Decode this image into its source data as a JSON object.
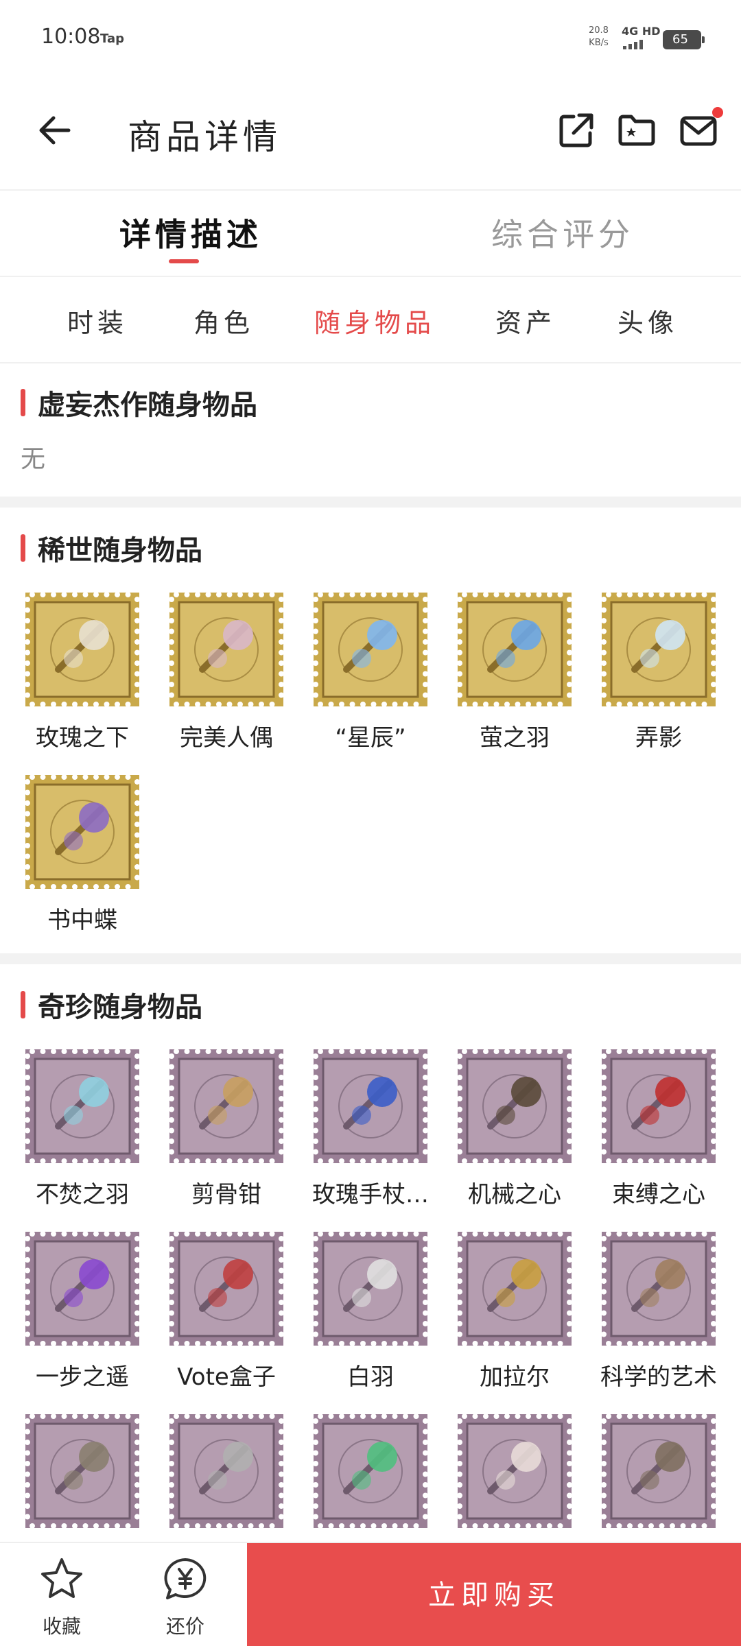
{
  "status": {
    "time": "10:08",
    "app_tag": "Tap",
    "speed_value": "20.8",
    "speed_unit": "KB/s",
    "network": "4G HD",
    "battery": "65"
  },
  "header": {
    "title": "商品详情"
  },
  "tabs": [
    {
      "label": "详情描述",
      "active": true
    },
    {
      "label": "综合评分",
      "active": false
    }
  ],
  "subtabs": [
    {
      "label": "时装",
      "active": false
    },
    {
      "label": "角色",
      "active": false
    },
    {
      "label": "随身物品",
      "active": true
    },
    {
      "label": "资产",
      "active": false
    },
    {
      "label": "头像",
      "active": false
    }
  ],
  "sections": {
    "masterpiece": {
      "title": "虚妄杰作随身物品",
      "empty_text": "无"
    },
    "rare": {
      "title": "稀世随身物品",
      "items": [
        "玫瑰之下",
        "完美人偶",
        "“星辰”",
        "萤之羽",
        "弄影",
        "书中蝶"
      ]
    },
    "treasure": {
      "title": "奇珍随身物品",
      "items": [
        "不焚之羽",
        "剪骨钳",
        "玫瑰手杖…",
        "机械之心",
        "束缚之心",
        "一步之遥",
        "Vote盒子",
        "白羽",
        "加拉尔",
        "科学的艺术",
        "",
        "",
        "",
        "",
        ""
      ]
    }
  },
  "bottom": {
    "favorite_label": "收藏",
    "bargain_label": "还价",
    "buy_label": "立即购买"
  },
  "colors": {
    "accent": "#e44a4a",
    "gold_stamp": "#c9a94a",
    "purple_stamp": "#9a7f96"
  }
}
